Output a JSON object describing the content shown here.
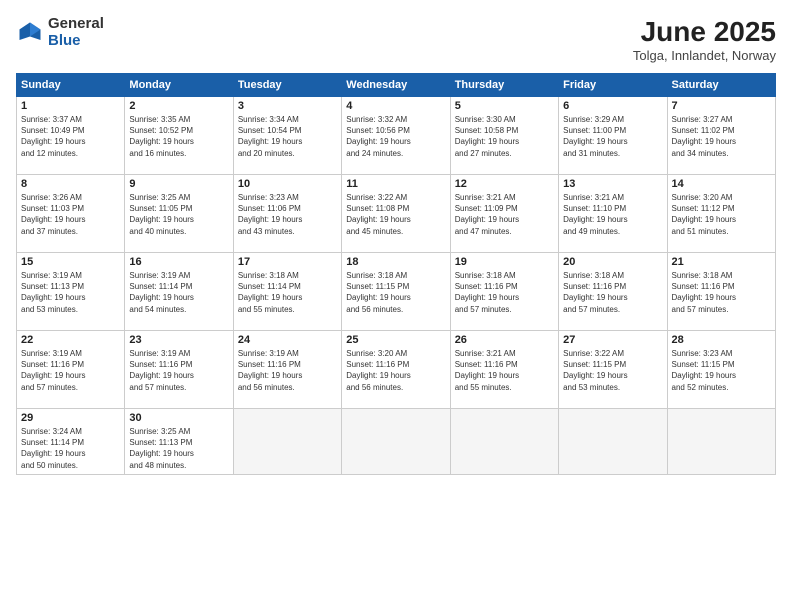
{
  "logo": {
    "general": "General",
    "blue": "Blue"
  },
  "title": "June 2025",
  "subtitle": "Tolga, Innlandet, Norway",
  "headers": [
    "Sunday",
    "Monday",
    "Tuesday",
    "Wednesday",
    "Thursday",
    "Friday",
    "Saturday"
  ],
  "weeks": [
    [
      {
        "day": "1",
        "info": "Sunrise: 3:37 AM\nSunset: 10:49 PM\nDaylight: 19 hours\nand 12 minutes."
      },
      {
        "day": "2",
        "info": "Sunrise: 3:35 AM\nSunset: 10:52 PM\nDaylight: 19 hours\nand 16 minutes."
      },
      {
        "day": "3",
        "info": "Sunrise: 3:34 AM\nSunset: 10:54 PM\nDaylight: 19 hours\nand 20 minutes."
      },
      {
        "day": "4",
        "info": "Sunrise: 3:32 AM\nSunset: 10:56 PM\nDaylight: 19 hours\nand 24 minutes."
      },
      {
        "day": "5",
        "info": "Sunrise: 3:30 AM\nSunset: 10:58 PM\nDaylight: 19 hours\nand 27 minutes."
      },
      {
        "day": "6",
        "info": "Sunrise: 3:29 AM\nSunset: 11:00 PM\nDaylight: 19 hours\nand 31 minutes."
      },
      {
        "day": "7",
        "info": "Sunrise: 3:27 AM\nSunset: 11:02 PM\nDaylight: 19 hours\nand 34 minutes."
      }
    ],
    [
      {
        "day": "8",
        "info": "Sunrise: 3:26 AM\nSunset: 11:03 PM\nDaylight: 19 hours\nand 37 minutes."
      },
      {
        "day": "9",
        "info": "Sunrise: 3:25 AM\nSunset: 11:05 PM\nDaylight: 19 hours\nand 40 minutes."
      },
      {
        "day": "10",
        "info": "Sunrise: 3:23 AM\nSunset: 11:06 PM\nDaylight: 19 hours\nand 43 minutes."
      },
      {
        "day": "11",
        "info": "Sunrise: 3:22 AM\nSunset: 11:08 PM\nDaylight: 19 hours\nand 45 minutes."
      },
      {
        "day": "12",
        "info": "Sunrise: 3:21 AM\nSunset: 11:09 PM\nDaylight: 19 hours\nand 47 minutes."
      },
      {
        "day": "13",
        "info": "Sunrise: 3:21 AM\nSunset: 11:10 PM\nDaylight: 19 hours\nand 49 minutes."
      },
      {
        "day": "14",
        "info": "Sunrise: 3:20 AM\nSunset: 11:12 PM\nDaylight: 19 hours\nand 51 minutes."
      }
    ],
    [
      {
        "day": "15",
        "info": "Sunrise: 3:19 AM\nSunset: 11:13 PM\nDaylight: 19 hours\nand 53 minutes."
      },
      {
        "day": "16",
        "info": "Sunrise: 3:19 AM\nSunset: 11:14 PM\nDaylight: 19 hours\nand 54 minutes."
      },
      {
        "day": "17",
        "info": "Sunrise: 3:18 AM\nSunset: 11:14 PM\nDaylight: 19 hours\nand 55 minutes."
      },
      {
        "day": "18",
        "info": "Sunrise: 3:18 AM\nSunset: 11:15 PM\nDaylight: 19 hours\nand 56 minutes."
      },
      {
        "day": "19",
        "info": "Sunrise: 3:18 AM\nSunset: 11:16 PM\nDaylight: 19 hours\nand 57 minutes."
      },
      {
        "day": "20",
        "info": "Sunrise: 3:18 AM\nSunset: 11:16 PM\nDaylight: 19 hours\nand 57 minutes."
      },
      {
        "day": "21",
        "info": "Sunrise: 3:18 AM\nSunset: 11:16 PM\nDaylight: 19 hours\nand 57 minutes."
      }
    ],
    [
      {
        "day": "22",
        "info": "Sunrise: 3:19 AM\nSunset: 11:16 PM\nDaylight: 19 hours\nand 57 minutes."
      },
      {
        "day": "23",
        "info": "Sunrise: 3:19 AM\nSunset: 11:16 PM\nDaylight: 19 hours\nand 57 minutes."
      },
      {
        "day": "24",
        "info": "Sunrise: 3:19 AM\nSunset: 11:16 PM\nDaylight: 19 hours\nand 56 minutes."
      },
      {
        "day": "25",
        "info": "Sunrise: 3:20 AM\nSunset: 11:16 PM\nDaylight: 19 hours\nand 56 minutes."
      },
      {
        "day": "26",
        "info": "Sunrise: 3:21 AM\nSunset: 11:16 PM\nDaylight: 19 hours\nand 55 minutes."
      },
      {
        "day": "27",
        "info": "Sunrise: 3:22 AM\nSunset: 11:15 PM\nDaylight: 19 hours\nand 53 minutes."
      },
      {
        "day": "28",
        "info": "Sunrise: 3:23 AM\nSunset: 11:15 PM\nDaylight: 19 hours\nand 52 minutes."
      }
    ],
    [
      {
        "day": "29",
        "info": "Sunrise: 3:24 AM\nSunset: 11:14 PM\nDaylight: 19 hours\nand 50 minutes."
      },
      {
        "day": "30",
        "info": "Sunrise: 3:25 AM\nSunset: 11:13 PM\nDaylight: 19 hours\nand 48 minutes."
      },
      {
        "day": "",
        "info": ""
      },
      {
        "day": "",
        "info": ""
      },
      {
        "day": "",
        "info": ""
      },
      {
        "day": "",
        "info": ""
      },
      {
        "day": "",
        "info": ""
      }
    ]
  ]
}
